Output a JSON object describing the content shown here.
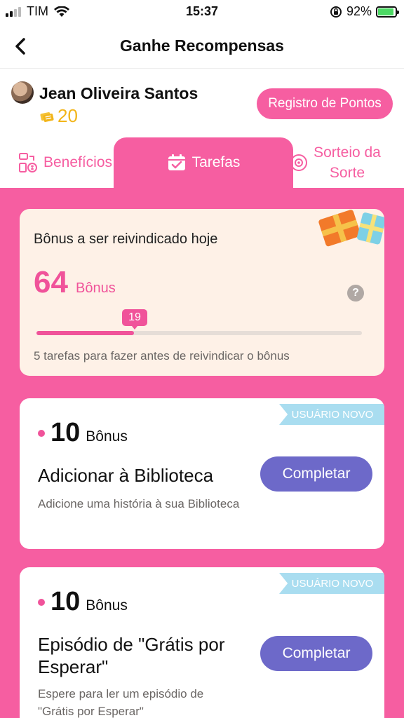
{
  "status_bar": {
    "carrier": "TIM",
    "time": "15:37",
    "battery_percent": "92%",
    "icons": [
      "signal-bars-icon",
      "wifi-icon",
      "orientation-lock-icon",
      "battery-charging-icon"
    ]
  },
  "nav": {
    "title": "Ganhe Recompensas",
    "back_icon": "chevron-left-icon"
  },
  "user": {
    "name": "Jean Oliveira Santos",
    "points": "20",
    "points_icon": "coins-icon",
    "register_button": "Registro de Pontos"
  },
  "tabs": [
    {
      "label": "Benefícios",
      "icon": "benefits-icon",
      "active": false
    },
    {
      "label": "Tarefas",
      "icon": "calendar-check-icon",
      "active": true
    },
    {
      "label": "Sorteio da Sorte",
      "label_line1": "Sorteio da",
      "label_line2": "Sorte",
      "icon": "wheel-icon",
      "active": false
    }
  ],
  "summary": {
    "title": "Bônus a ser reivindicado hoje",
    "bonus_value": "64",
    "bonus_unit": "Bônus",
    "help_label": "?",
    "progress_value": "19",
    "progress_fraction": 0.3,
    "note": "5 tarefas para fazer antes de reivindicar o bônus",
    "decoration_icon": "gift-boxes-icon"
  },
  "tasks": [
    {
      "badge": "USUÁRIO NOVO",
      "bonus_value": "10",
      "bonus_unit": "Bônus",
      "title": "Adicionar à Biblioteca",
      "description": "Adicione uma história à sua Biblioteca",
      "button": "Completar"
    },
    {
      "badge": "USUÁRIO NOVO",
      "bonus_value": "10",
      "bonus_unit": "Bônus",
      "title": "Episódio de \"Grátis por Esperar\"",
      "description": "Espere para ler um episódio de \"Grátis por Esperar\"",
      "button": "Completar"
    }
  ],
  "colors": {
    "brand_pink": "#f65ea1",
    "button_purple": "#6d69c9",
    "summary_bg": "#fef1e7",
    "badge_blue": "#a9ddf0",
    "coin_gold": "#f2b51a"
  }
}
